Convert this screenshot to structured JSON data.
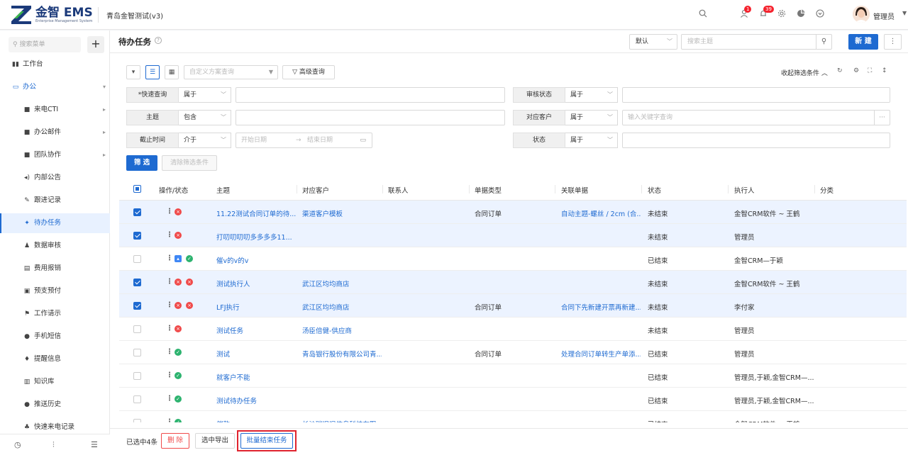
{
  "brand": {
    "name": "金智 EMS",
    "subtitle": "Enterprise Management System"
  },
  "header": {
    "company": "青岛金智测试(v3)",
    "badge_contacts": "1",
    "badge_notifications": "39",
    "user_name": "管理员"
  },
  "sidebar": {
    "search_placeholder": "搜索菜单",
    "items": [
      {
        "label": "工作台",
        "icon": "dashboard-icon"
      },
      {
        "label": "办公",
        "icon": "office-icon"
      },
      {
        "label": "来电CTI",
        "icon": "folder-icon"
      },
      {
        "label": "办公邮件",
        "icon": "folder-icon"
      },
      {
        "label": "团队协作",
        "icon": "folder-icon"
      },
      {
        "label": "内部公告",
        "icon": "announcement-icon"
      },
      {
        "label": "跟进记录",
        "icon": "edit-icon"
      },
      {
        "label": "待办任务",
        "icon": "pin-icon"
      },
      {
        "label": "数据审核",
        "icon": "audit-icon"
      },
      {
        "label": "费用报销",
        "icon": "receipt-icon"
      },
      {
        "label": "预支预付",
        "icon": "prepay-icon"
      },
      {
        "label": "工作请示",
        "icon": "flag-icon"
      },
      {
        "label": "手机短信",
        "icon": "sms-icon"
      },
      {
        "label": "提醒信息",
        "icon": "bell-icon"
      },
      {
        "label": "知识库",
        "icon": "book-icon"
      },
      {
        "label": "推送历史",
        "icon": "push-icon"
      },
      {
        "label": "快速来电记录",
        "icon": "phone-icon"
      }
    ]
  },
  "page": {
    "title": "待办任务",
    "view_select": "默认",
    "search_placeholder": "搜索主题",
    "new_button": "新 建"
  },
  "filter": {
    "scheme_placeholder": "自定义方案查询",
    "advanced": "高级查询",
    "collapse": "收起筛选条件",
    "rows": {
      "quick": {
        "label": "*快速查询",
        "op": "属于"
      },
      "review": {
        "label": "审核状态",
        "op": "属于"
      },
      "subject": {
        "label": "主题",
        "op": "包含"
      },
      "customer": {
        "label": "对应客户",
        "op": "属于",
        "placeholder": "输入关键字查询"
      },
      "deadline": {
        "label": "截止时间",
        "op": "介于",
        "start": "开始日期",
        "end": "结束日期"
      },
      "status": {
        "label": "状态",
        "op": "属于"
      }
    },
    "filter_button": "筛 选",
    "clear_button": "清除筛选条件"
  },
  "table": {
    "columns": [
      "操作/状态",
      "主题",
      "对应客户",
      "联系人",
      "单据类型",
      "关联单据",
      "状态",
      "执行人",
      "分类"
    ],
    "rows": [
      {
        "checked": true,
        "icons": [
          "red"
        ],
        "subject": "11.22测试合同订单的待...",
        "customer": "渠道客户模板",
        "contact": "",
        "doctype": "合同订单",
        "related": "自动主题-螺丝 / 2cm (合...",
        "status": "未结束",
        "executor": "金智CRM软件 ~ 王鹤"
      },
      {
        "checked": true,
        "icons": [
          "red"
        ],
        "subject": "打叨叨叨叨多多多多11...",
        "customer": "",
        "contact": "",
        "doctype": "",
        "related": "",
        "status": "未结束",
        "executor": "管理员"
      },
      {
        "checked": false,
        "icons": [
          "blue",
          "green"
        ],
        "subject": "催v的v的v",
        "customer": "",
        "contact": "",
        "doctype": "",
        "related": "",
        "status": "已结束",
        "executor": "金智CRM—于颖"
      },
      {
        "checked": true,
        "icons": [
          "red",
          "red"
        ],
        "subject": "测试执行人",
        "customer": "武江区均均商店",
        "contact": "",
        "doctype": "",
        "related": "",
        "status": "未结束",
        "executor": "金智CRM软件 ~ 王鹤"
      },
      {
        "checked": true,
        "icons": [
          "red",
          "red"
        ],
        "subject": "LFJ执行",
        "customer": "武江区均均商店",
        "contact": "",
        "doctype": "合同订单",
        "related": "合同下先新建开票再新建...",
        "status": "未结束",
        "executor": "李付家"
      },
      {
        "checked": false,
        "icons": [
          "red"
        ],
        "subject": "测试任务",
        "customer": "汤臣倍健-供应商",
        "contact": "",
        "doctype": "",
        "related": "",
        "status": "未结束",
        "executor": "管理员"
      },
      {
        "checked": false,
        "icons": [
          "green"
        ],
        "subject": "测试",
        "customer": "青岛银行股份有限公司青...",
        "contact": "",
        "doctype": "合同订单",
        "related": "处理合同订单转生产单添...",
        "status": "已结束",
        "executor": "管理员"
      },
      {
        "checked": false,
        "icons": [
          "green"
        ],
        "subject": "就客户不能",
        "customer": "",
        "contact": "",
        "doctype": "",
        "related": "",
        "status": "已结束",
        "executor": "管理员,于颖,金智CRM—..."
      },
      {
        "checked": false,
        "icons": [
          "green"
        ],
        "subject": "测试待办任务",
        "customer": "",
        "contact": "",
        "doctype": "",
        "related": "",
        "status": "已结束",
        "executor": "管理员,于颖,金智CRM—..."
      },
      {
        "checked": false,
        "icons": [
          "green"
        ],
        "subject": "催款",
        "customer": "长沙瑞旧旧信息科技有限...",
        "contact": "",
        "doctype": "",
        "related": "",
        "status": "已结束",
        "executor": "金智CRM软件 ~ 王鹤"
      }
    ]
  },
  "footer": {
    "selected": "已选中4条",
    "delete": "删 除",
    "export": "选中导出",
    "batch_end": "批量结束任务"
  },
  "colors": {
    "accent": "#1e6ad1",
    "danger": "#f04a4a",
    "success": "#2db36f",
    "selected_row": "#ecf3ff"
  }
}
